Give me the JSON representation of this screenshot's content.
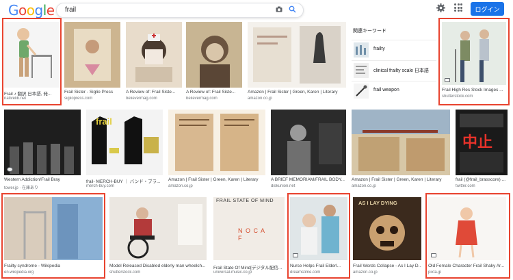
{
  "header": {
    "logo_letters": [
      "G",
      "o",
      "o",
      "g",
      "l",
      "e"
    ],
    "logo_colors": [
      "#4285f4",
      "#ea4335",
      "#fbbc05",
      "#4285f4",
      "#34a853",
      "#ea4335"
    ],
    "query": "frail",
    "login_label": "ログイン"
  },
  "related": {
    "title": "関連キーワード",
    "items": [
      {
        "label": "frailty"
      },
      {
        "label": "clinical frailty scale 日本語"
      },
      {
        "label": "frail weapon"
      }
    ]
  },
  "results": [
    {
      "caption": "Frail ♪ 翻訳 日本語, 発...",
      "domain": "nativelib.net"
    },
    {
      "caption": "Frail Sister - Siglio Press",
      "domain": "sigliopress.com"
    },
    {
      "caption": "A Review of: Frail Siste...",
      "domain": "believermag.com"
    },
    {
      "caption": "A Review of: Frail Siste...",
      "domain": "believermag.com"
    },
    {
      "caption": "Amazon | Frail Sister | Green, Karen | Literary",
      "domain": "amazon.co.jp"
    },
    {
      "caption": "Frail High Res Stock Images ...",
      "domain": "shutterstock.com"
    },
    {
      "caption": "Western Addiction/Frail Bray",
      "domain": "tower.jp · 在庫あり"
    },
    {
      "caption": "frail- MERCH-BUY ｜ バンド・ブラ...",
      "domain": "merch-buy.com"
    },
    {
      "caption": "Amazon | Frail Sister | Green, Karen | Literary",
      "domain": "amazon.co.jp"
    },
    {
      "caption": "A BRIEF MEMORIAM/FRAIL BODY...",
      "domain": "diskunion.net"
    },
    {
      "caption": "Amazon | Frail Sister | Green, Karen | Literary",
      "domain": "amazon.co.jp"
    },
    {
      "caption": "frail (@frail_brasscore) ...",
      "domain": "twitter.com"
    },
    {
      "caption": "Frailty syndrome - Wikipedia",
      "domain": "en.wikipedia.org"
    },
    {
      "caption": "Model Released Disabled elderly man wheelch...",
      "domain": "shutterstock.com"
    },
    {
      "caption": "Frail State Of Mind[デジタル配信...",
      "domain": "universal-music.co.jp"
    },
    {
      "caption": "Nurse Helps Frail Elderl...",
      "domain": "dreamstime.com"
    },
    {
      "caption": "Frail Words Collapse - As I Lay D...",
      "domain": "amazon.co.jp"
    },
    {
      "caption": "Old Female Character Frail Shaky Ar...",
      "domain": "pixta.jp"
    }
  ],
  "image_text": {
    "frail_shirt": "frail",
    "frail_state": "FRAIL STATE OF MIND",
    "nocaf": "N O C A F",
    "aild": "AS I LAY DYING",
    "poster": "中止"
  }
}
